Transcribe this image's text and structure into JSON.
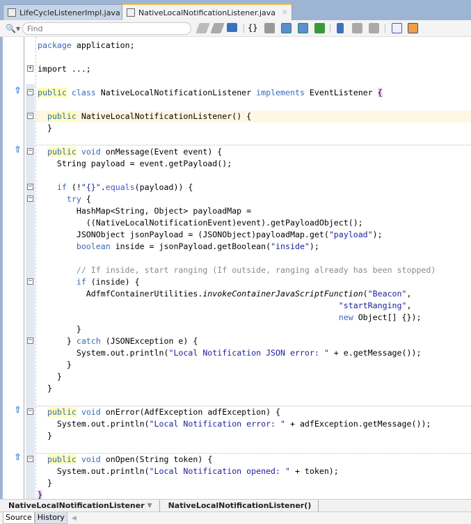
{
  "tabs": [
    {
      "label": "LifeCycleListenerImpl.java",
      "active": false
    },
    {
      "label": "NativeLocalNotificationListener.java",
      "active": true
    }
  ],
  "toolbar": {
    "find_placeholder": "Find",
    "icons": [
      "prev-occurrence-icon",
      "next-occurrence-icon",
      "toggle-highlight-icon",
      "braces-icon",
      "history-icon",
      "shift-left-icon",
      "shift-right-icon",
      "comment-icon",
      "bookmark-icon",
      "prev-bookmark-icon",
      "next-bookmark-icon",
      "macro-record-icon",
      "macro-play-icon"
    ]
  },
  "code": {
    "lines": [
      [
        [
          "kw",
          "package"
        ],
        [
          "t",
          " application;"
        ]
      ],
      [],
      [
        [
          "t",
          "import ...;"
        ]
      ],
      [],
      [
        [
          "kw hl",
          "public"
        ],
        [
          "t",
          " "
        ],
        [
          "kw",
          "class"
        ],
        [
          "t",
          " NativeLocalNotificationListener "
        ],
        [
          "kw",
          "implements"
        ],
        [
          "t",
          " EventListener "
        ],
        [
          "br",
          "{"
        ]
      ],
      [],
      [
        [
          "t",
          "  "
        ],
        [
          "kw hl",
          "public"
        ],
        [
          "t",
          " NativeLocalNotificationListener() {"
        ]
      ],
      [
        [
          "t",
          "  }"
        ]
      ],
      [],
      [
        [
          "t",
          "  "
        ],
        [
          "kw hl",
          "public"
        ],
        [
          "t",
          " "
        ],
        [
          "kw",
          "void"
        ],
        [
          "t",
          " onMessage(Event event) {"
        ]
      ],
      [
        [
          "t",
          "    String payload = event.getPayload();"
        ]
      ],
      [],
      [
        [
          "t",
          "    "
        ],
        [
          "kw",
          "if"
        ],
        [
          "t",
          " (!"
        ],
        [
          "str",
          "\"{}\""
        ],
        [
          "t",
          "."
        ],
        [
          "mth",
          "equals"
        ],
        [
          "t",
          "(payload)) {"
        ]
      ],
      [
        [
          "t",
          "      "
        ],
        [
          "kw",
          "try"
        ],
        [
          "t",
          " {"
        ]
      ],
      [
        [
          "t",
          "        HashMap<String, Object> payloadMap ="
        ]
      ],
      [
        [
          "t",
          "          ((NativeLocalNotificationEvent)event).getPayloadObject();"
        ]
      ],
      [
        [
          "t",
          "        JSONObject jsonPayload = (JSONObject)payloadMap.get("
        ],
        [
          "str",
          "\"payload\""
        ],
        [
          "t",
          ");"
        ]
      ],
      [
        [
          "t",
          "        "
        ],
        [
          "kw",
          "boolean"
        ],
        [
          "t",
          " inside = jsonPayload.getBoolean("
        ],
        [
          "str",
          "\"inside\""
        ],
        [
          "t",
          ");"
        ]
      ],
      [],
      [
        [
          "t",
          "        "
        ],
        [
          "cm",
          "// If inside, start ranging (If outside, ranging already has been stopped)"
        ]
      ],
      [
        [
          "t",
          "        "
        ],
        [
          "kw",
          "if"
        ],
        [
          "t",
          " (inside) {"
        ]
      ],
      [
        [
          "t",
          "          AdfmfContainerUtilities."
        ],
        [
          "it",
          "invokeContainerJavaScriptFunction"
        ],
        [
          "t",
          "("
        ],
        [
          "str",
          "\"Beacon\""
        ],
        [
          "t",
          ","
        ]
      ],
      [
        [
          "t",
          "                                                              "
        ],
        [
          "str",
          "\"startRanging\""
        ],
        [
          "t",
          ","
        ]
      ],
      [
        [
          "t",
          "                                                              "
        ],
        [
          "kw",
          "new"
        ],
        [
          "t",
          " Object[] {});"
        ]
      ],
      [
        [
          "t",
          "        }"
        ]
      ],
      [
        [
          "t",
          "      } "
        ],
        [
          "kw",
          "catch"
        ],
        [
          "t",
          " (JSONException e) {"
        ]
      ],
      [
        [
          "t",
          "        System.out.println("
        ],
        [
          "str",
          "\"Local Notification JSON error: \""
        ],
        [
          "t",
          " + e.getMessage());"
        ]
      ],
      [
        [
          "t",
          "      }"
        ]
      ],
      [
        [
          "t",
          "    }"
        ]
      ],
      [
        [
          "t",
          "  }"
        ]
      ],
      [],
      [
        [
          "t",
          "  "
        ],
        [
          "kw hl",
          "public"
        ],
        [
          "t",
          " "
        ],
        [
          "kw",
          "void"
        ],
        [
          "t",
          " onError(AdfException adfException) {"
        ]
      ],
      [
        [
          "t",
          "    System.out.println("
        ],
        [
          "str",
          "\"Local Notification error: \""
        ],
        [
          "t",
          " + adfException.getMessage());"
        ]
      ],
      [
        [
          "t",
          "  }"
        ]
      ],
      [],
      [
        [
          "t",
          "  "
        ],
        [
          "kw hl",
          "public"
        ],
        [
          "t",
          " "
        ],
        [
          "kw",
          "void"
        ],
        [
          "t",
          " onOpen(String token) {"
        ]
      ],
      [
        [
          "t",
          "    System.out.println("
        ],
        [
          "str",
          "\"Local Notification opened: \""
        ],
        [
          "t",
          " + token);"
        ]
      ],
      [
        [
          "t",
          "  }"
        ]
      ],
      [
        [
          "br",
          "}"
        ]
      ]
    ]
  },
  "breadcrumbs": [
    "NativeLocalNotificationListener",
    "NativeLocalNotificationListener()"
  ],
  "bottom_tabs": [
    "Source",
    "History"
  ]
}
